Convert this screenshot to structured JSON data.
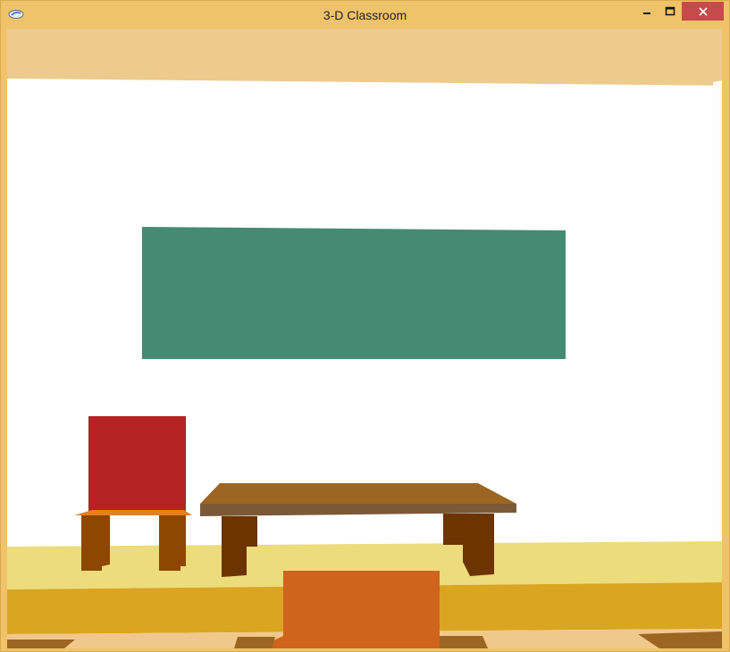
{
  "window": {
    "title": "3-D Classroom",
    "icon": "app-icon",
    "controls": [
      "minimize-icon",
      "maximize-icon",
      "close-icon"
    ]
  },
  "colors": {
    "frame": "#f0c36a",
    "ceiling": "#edcb8c",
    "wall": "#ffffff",
    "chalkboard": "#458a73",
    "chair_back": "#b42224",
    "chair_seat": "#e5801f",
    "chair_legs": "#8d4701",
    "desk_top": "#9c6522",
    "desk_edge": "#7b5838",
    "desk_legs": "#6b3401",
    "floor_near": "#ecdc7c",
    "floor_band": "#daa520",
    "floor_front": "#f1c88c",
    "front_object": "#cf641d",
    "close_button": "#c74a4a"
  }
}
